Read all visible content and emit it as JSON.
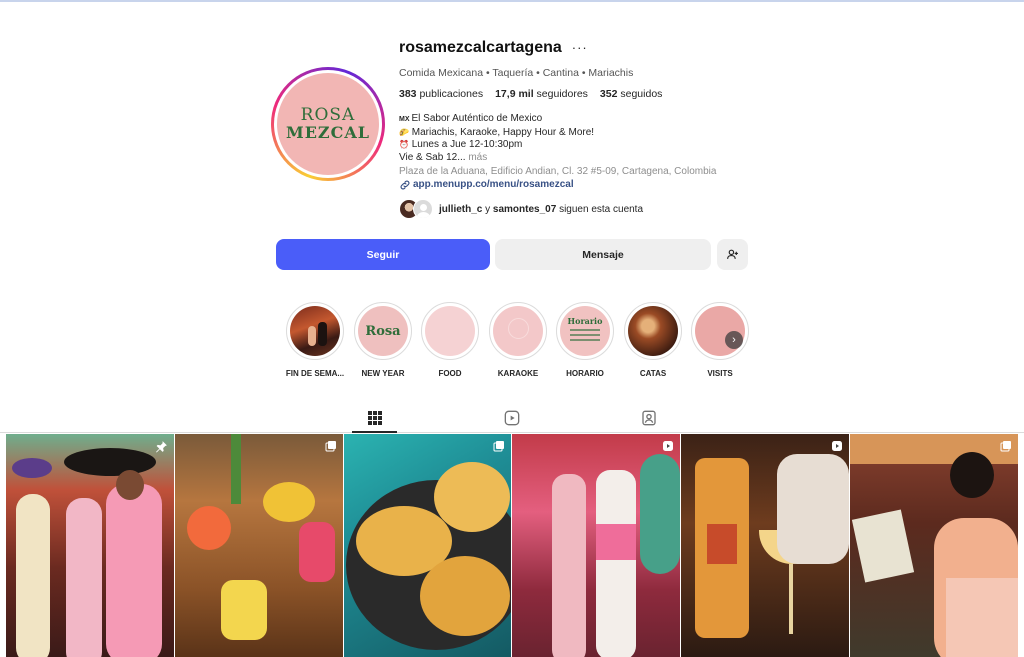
{
  "profile": {
    "username": "rosamezcalcartagena",
    "more_label": "···",
    "category": "Comida Mexicana • Taquería • Cantina • Mariachis",
    "stats": {
      "posts_count": "383",
      "posts_label": "publicaciones",
      "followers_count": "17,9 mil",
      "followers_label": "seguidores",
      "following_count": "352",
      "following_label": "seguidos"
    },
    "logo": {
      "line1": "ROSA",
      "line2": "MEZCAL"
    },
    "bio": {
      "line1_flag": "MX",
      "line1": "El Sabor Auténtico de Mexico",
      "line2_icon": "🌮",
      "line2": "Mariachis, Karaoke, Happy Hour & More!",
      "line3_icon": "⏰",
      "line3": "Lunes a Jue 12-10:30pm",
      "line4": "Vie & Sab 12...",
      "more": "más"
    },
    "address": "Plaza de la Aduana, Edificio Andian, Cl. 32 #5-09, Cartagena, Colombia",
    "link": "app.menupp.co/menu/rosamezcal",
    "followed_by": {
      "user1": "jullieth_c",
      "conj": " y ",
      "user2": "samontes_07",
      "suffix": " siguen esta cuenta"
    }
  },
  "actions": {
    "follow": "Seguir",
    "message": "Mensaje"
  },
  "highlights": [
    {
      "label": "FIN DE SEMA..."
    },
    {
      "label": "NEW YEAR"
    },
    {
      "label": "FOOD"
    },
    {
      "label": "KARAOKE"
    },
    {
      "label": "HORARIO"
    },
    {
      "label": "CATAS"
    },
    {
      "label": "VISITS"
    }
  ],
  "highlight_text": {
    "new_year": "Rosa",
    "horario": "Horario"
  },
  "tabs": [
    "posts-grid-icon",
    "reels-icon",
    "tagged-icon"
  ],
  "colors": {
    "follow": "#4a5df9",
    "brand_green": "#2f6d3a",
    "brand_pink": "#f2b6b4"
  }
}
